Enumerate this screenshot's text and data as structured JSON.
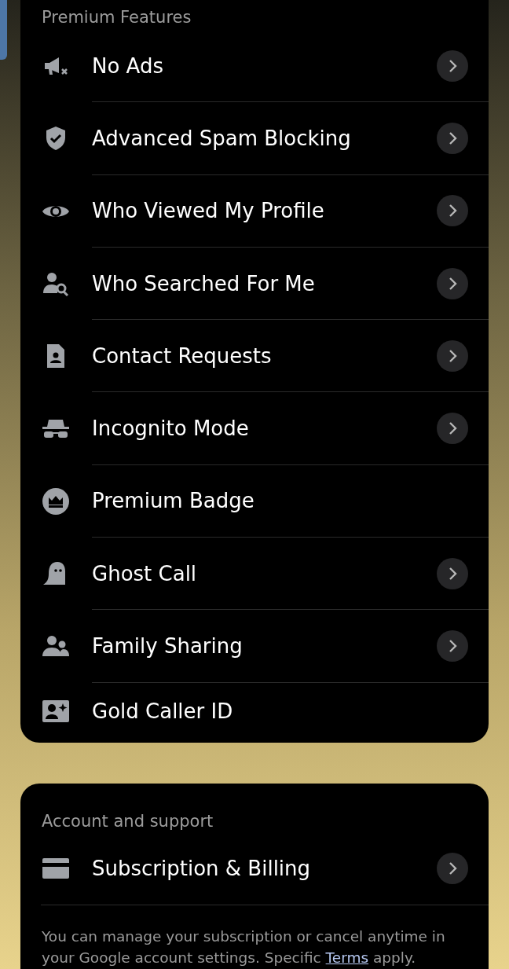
{
  "premium_features": {
    "title": "Premium Features",
    "items": [
      {
        "label": "No Ads",
        "chevron": true
      },
      {
        "label": "Advanced Spam Blocking",
        "chevron": true
      },
      {
        "label": "Who Viewed My Profile",
        "chevron": true
      },
      {
        "label": "Who Searched For Me",
        "chevron": true
      },
      {
        "label": "Contact Requests",
        "chevron": true
      },
      {
        "label": "Incognito Mode",
        "chevron": true
      },
      {
        "label": "Premium Badge",
        "chevron": false
      },
      {
        "label": "Ghost Call",
        "chevron": true
      },
      {
        "label": "Family Sharing",
        "chevron": true
      },
      {
        "label": "Gold Caller ID",
        "chevron": false
      }
    ]
  },
  "account_and_support": {
    "title": "Account and support",
    "items": [
      {
        "label": "Subscription & Billing",
        "chevron": true
      }
    ],
    "footer": {
      "text_before": "You can manage your subscription or cancel anytime in your Google account settings. Specific",
      "link": "Terms",
      "text_after": "apply."
    }
  }
}
